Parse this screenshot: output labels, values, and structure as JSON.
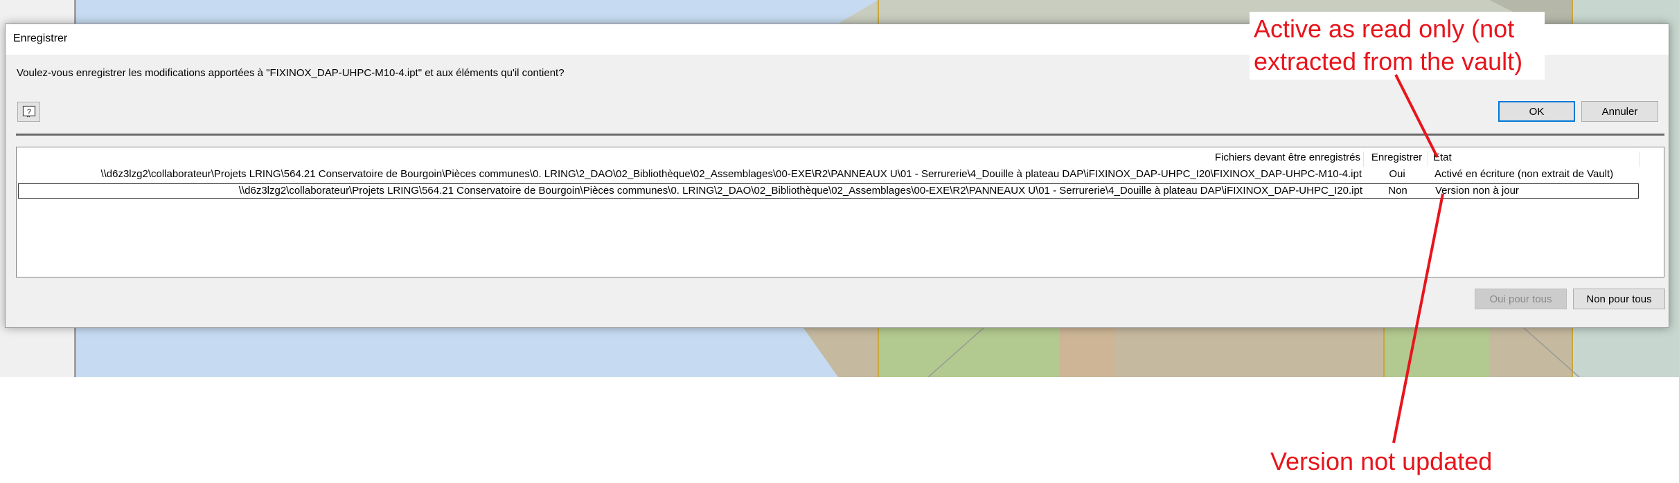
{
  "dialog": {
    "title": "Enregistrer",
    "question": "Voulez-vous enregistrer les modifications apportées à \"FIXINOX_DAP-UHPC-M10-4.ipt\" et aux éléments qu'il contient?",
    "buttons": {
      "ok": "OK",
      "cancel": "Annuler",
      "yes_to_all": "Oui pour tous",
      "no_to_all": "Non pour tous"
    },
    "list": {
      "headers": {
        "files": "Fichiers devant être enregistrés",
        "save": "Enregistrer",
        "state": "Etat"
      },
      "rows": [
        {
          "path": "\\\\d6z3lzg2\\collaborateur\\Projets LRING\\564.21 Conservatoire de Bourgoin\\Pièces communes\\0. LRING\\2_DAO\\02_Bibliothèque\\02_Assemblages\\00-EXE\\R2\\PANNEAUX U\\01 - Serrurerie\\4_Douille à plateau DAP\\iFIXINOX_DAP-UHPC_I20\\FIXINOX_DAP-UHPC-M10-4.ipt",
          "save": "Oui",
          "state": "Activé en écriture (non extrait de Vault)"
        },
        {
          "path": "\\\\d6z3lzg2\\collaborateur\\Projets LRING\\564.21 Conservatoire de Bourgoin\\Pièces communes\\0. LRING\\2_DAO\\02_Bibliothèque\\02_Assemblages\\00-EXE\\R2\\PANNEAUX U\\01 - Serrurerie\\4_Douille à plateau DAP\\iFIXINOX_DAP-UHPC_I20.ipt",
          "save": "Non",
          "state": "Version non à jour"
        }
      ]
    }
  },
  "annotations": {
    "active_line_1": "Active as read only (not",
    "active_line_2": "extracted from the vault)",
    "version": "Version not updated",
    "color": "#e8141c"
  },
  "icons": {
    "help": "help-icon"
  }
}
